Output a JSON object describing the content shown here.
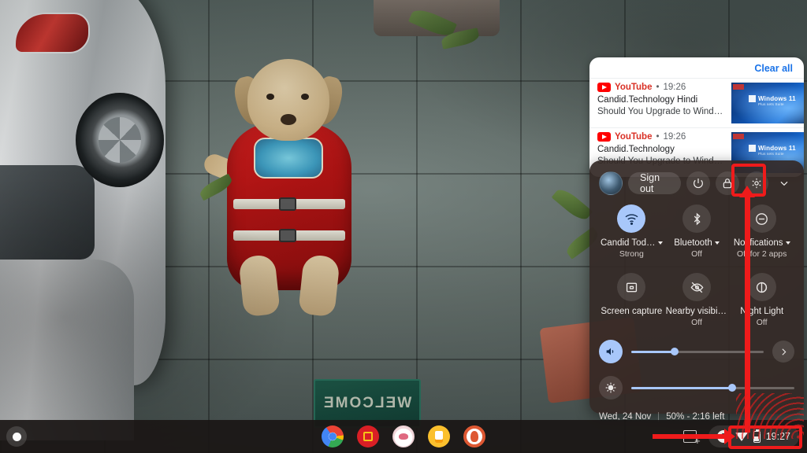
{
  "notifications": {
    "clear_all_label": "Clear all",
    "items": [
      {
        "app": "YouTube",
        "app_icon": "youtube-icon",
        "time": "19:26",
        "title": "Candid.Technology Hindi",
        "subtitle": "Should You Upgrade to Windows 1…",
        "thumbnail_label": "Windows 11",
        "thumbnail_sublabel": "Plus sets Suite"
      },
      {
        "app": "YouTube",
        "app_icon": "youtube-icon",
        "time": "19:26",
        "title": "Candid.Technology",
        "subtitle": "Should You Upgrade to Windows 1…",
        "thumbnail_label": "Windows 11",
        "thumbnail_sublabel": "Plus sets Suite"
      }
    ]
  },
  "quick_settings": {
    "sign_out_label": "Sign out",
    "power_icon": "power-icon",
    "lock_icon": "lock-icon",
    "settings_icon": "gear-icon",
    "collapse_icon": "chevron-down-icon",
    "avatar_name": "avatar",
    "tiles": [
      {
        "icon": "wifi-icon",
        "label": "Candid Today…",
        "state": "Strong",
        "active": true,
        "has_caret": true
      },
      {
        "icon": "bluetooth-icon",
        "label": "Bluetooth",
        "state": "Off",
        "active": false,
        "has_caret": true
      },
      {
        "icon": "do-not-disturb-icon",
        "label": "Notifications",
        "state": "Off for 2 apps",
        "active": false,
        "has_caret": true
      },
      {
        "icon": "screen-capture-icon",
        "label": "Screen capture",
        "state": "",
        "active": false,
        "has_caret": false
      },
      {
        "icon": "nearby-visibility-off-icon",
        "label": "Nearby visibil…",
        "state": "Off",
        "active": false,
        "has_caret": false
      },
      {
        "icon": "night-light-icon",
        "label": "Night Light",
        "state": "Off",
        "active": false,
        "has_caret": false
      }
    ],
    "volume": {
      "icon": "volume-icon",
      "value": 33,
      "next_icon": "chevron-right-icon"
    },
    "brightness": {
      "icon": "brightness-icon",
      "value": 62
    },
    "date": "Wed, 24 Nov",
    "battery": "50% - 2:16 left"
  },
  "shelf": {
    "launcher_name": "launcher-button",
    "apps": [
      {
        "name": "chrome",
        "class": "app-chrome"
      },
      {
        "name": "manchester-united",
        "class": "app-mufc"
      },
      {
        "name": "white-app",
        "class": "app-white"
      },
      {
        "name": "keep-notes",
        "class": "app-yellow"
      },
      {
        "name": "duckduckgo",
        "class": "app-ddg"
      }
    ],
    "capture_icon": "screen-capture-icon",
    "notification_count": "2",
    "wifi_icon": "wifi-icon",
    "battery_icon": "battery-icon",
    "time": "19:27"
  },
  "wallpaper": {
    "mat_text": "WELCOME"
  },
  "colors": {
    "accent_blue": "#a8c7fa",
    "link_blue": "#1a73e8",
    "youtube_red": "#d93025",
    "annotation_red": "#ef1b1b",
    "panel_bg": "#342926"
  }
}
